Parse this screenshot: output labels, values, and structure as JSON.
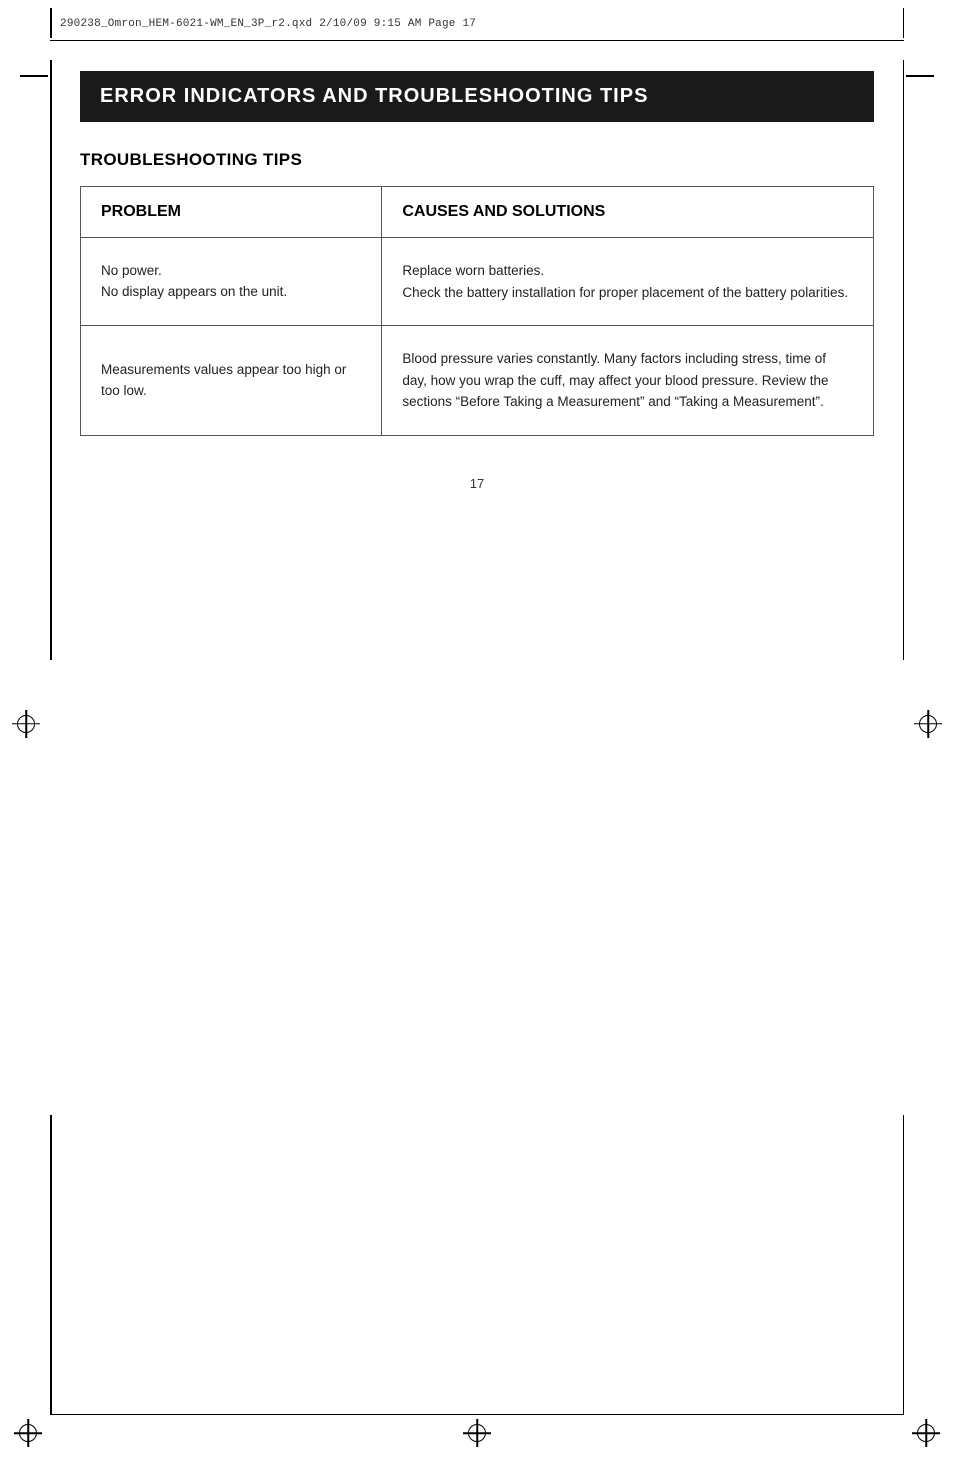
{
  "meta": {
    "file_info": "290238_Omron_HEM-6021-WM_EN_3P_r2.qxd   2/10/09   9:15 AM   Page 17",
    "page_number": "17"
  },
  "header": {
    "title": "ERROR INDICATORS AND TROUBLESHOOTING TIPS"
  },
  "section": {
    "title": "TROUBLESHOOTING TIPS"
  },
  "table": {
    "col_problem_header": "PROBLEM",
    "col_causes_header": "CAUSES AND SOLUTIONS",
    "rows": [
      {
        "problem": "No power.\nNo display appears on the unit.",
        "causes": "Replace worn batteries.\nCheck the battery installation for proper placement of the battery polarities."
      },
      {
        "problem": "Measurements values appear too high or too low.",
        "causes": "Blood pressure varies constantly. Many factors including stress, time of day, how you wrap the cuff, may affect your blood pressure. Review the sections “Before Taking a Measurement” and “Taking a Measurement”."
      }
    ]
  }
}
